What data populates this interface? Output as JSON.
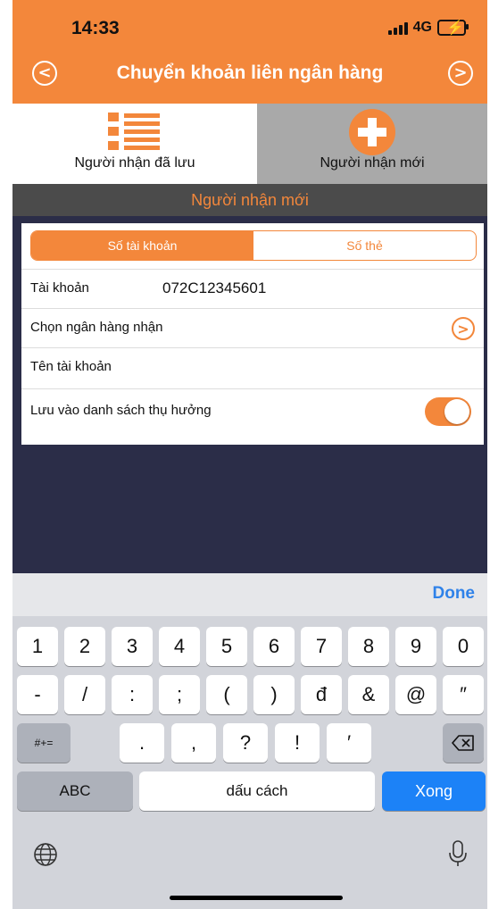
{
  "status_bar": {
    "time": "14:33",
    "network": "4G"
  },
  "nav": {
    "title": "Chuyển khoản liên ngân hàng",
    "back_icon": "chevron-left-circle-icon",
    "forward_icon": "chevron-right-circle-icon"
  },
  "recipient_tabs": [
    {
      "label": "Người nhận đã lưu",
      "icon": "list-icon",
      "selected": true
    },
    {
      "label": "Người nhận mới",
      "icon": "plus-circle-icon",
      "selected": false
    }
  ],
  "section_header": "Người nhận mới",
  "segment": {
    "options": [
      "Số tài khoản",
      "Số thẻ"
    ],
    "selected_index": 0
  },
  "form": {
    "account_label": "Tài khoản",
    "account_value": "072C12345601",
    "bank_label": "Chọn ngân hàng nhận",
    "account_name_label": "Tên tài khoản",
    "save_label": "Lưu vào danh sách thụ hưởng",
    "save_toggle_on": true
  },
  "keyboard": {
    "done_label": "Done",
    "row1": [
      "1",
      "2",
      "3",
      "4",
      "5",
      "6",
      "7",
      "8",
      "9",
      "0"
    ],
    "row2": [
      "-",
      "/",
      ":",
      ";",
      "(",
      ")",
      "đ",
      "&",
      "@",
      "″"
    ],
    "symbols_key": "#+=",
    "row3": [
      ".",
      ",",
      "?",
      "!",
      "′"
    ],
    "abc_key": "ABC",
    "space_key": "dấu cách",
    "return_key": "Xong"
  },
  "colors": {
    "accent": "#f3873b",
    "keyboard_blue": "#1c82f7",
    "done_blue": "#2f82e9"
  }
}
